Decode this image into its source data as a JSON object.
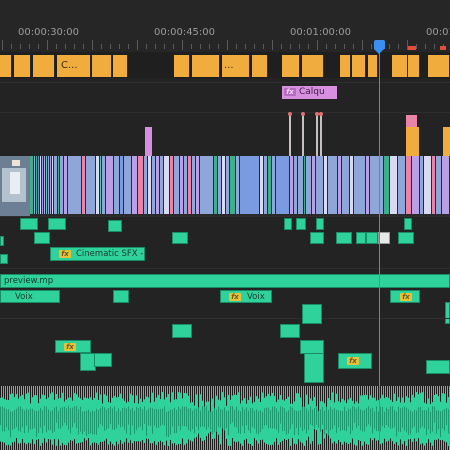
{
  "ruler": {
    "timecodes": [
      "00:00:30:00",
      "00:00:45:00",
      "00:01:00:00",
      "00:01"
    ]
  },
  "tracks": {
    "title_clip_1": "C...",
    "title_clip_2": "...",
    "adjustment_clip": "Calqu",
    "fx_badge": "fx",
    "sfx_clip": "Cinematic SFX -",
    "preview_clip": "preview.mp",
    "voice_clip_1": "Voix",
    "voice_clip_2": "Voix"
  },
  "colors": {
    "background": "#232323",
    "title_clip": "#f0ac3c",
    "adjustment_clip": "#d98fe0",
    "video_clip": "#8fa6d8",
    "audio_clip": "#2fd29a",
    "fx_badge": "#e6c23a",
    "playhead": "#3b8ff0"
  }
}
